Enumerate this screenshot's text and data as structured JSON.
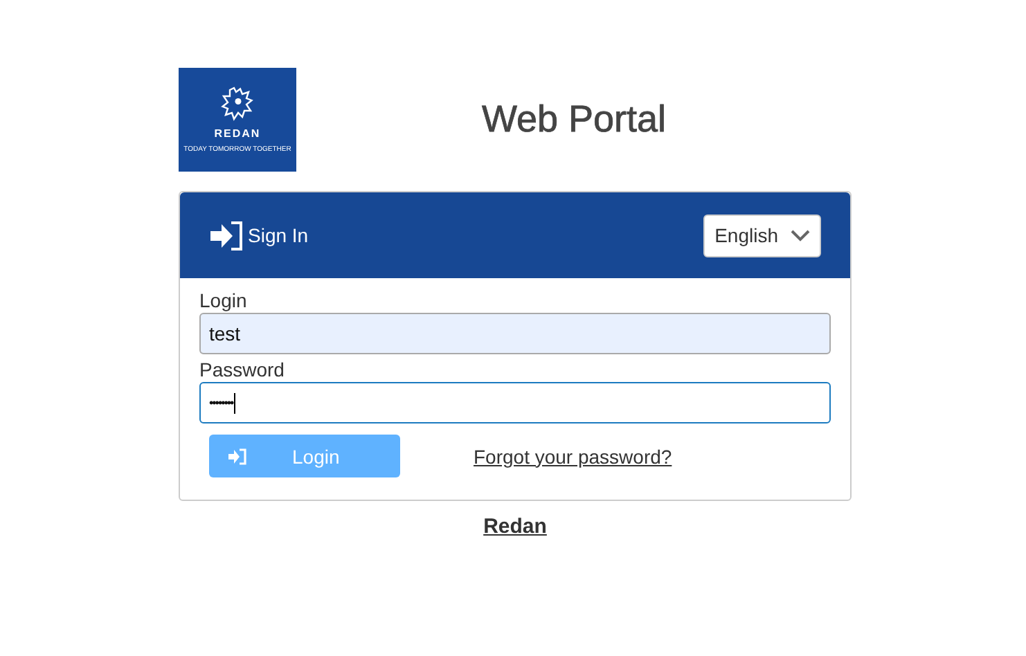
{
  "logo": {
    "name": "REDAN",
    "tagline": "TODAY TOMORROW TOGETHER"
  },
  "title": "Web Portal",
  "header": {
    "title": "Sign In",
    "language": "English"
  },
  "fields": [
    {
      "label": "Login",
      "value": "test",
      "kind": "text",
      "focused": false,
      "autofilled": true
    },
    {
      "label": "Password",
      "value": "••••••••",
      "kind": "password",
      "focused": true,
      "autofilled": false
    }
  ],
  "login_button": {
    "label": "Login",
    "disabled": true
  },
  "forgot_link": "Forgot your password?",
  "footer_link": "Redan"
}
